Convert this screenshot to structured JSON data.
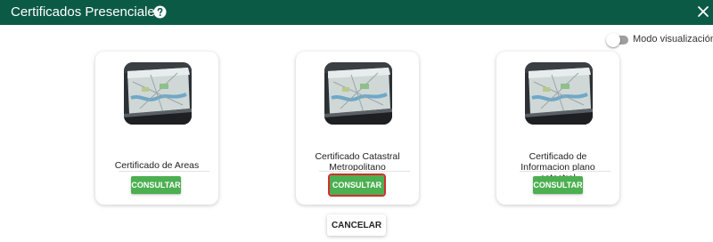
{
  "dialog": {
    "title": "Certificados Presenciales"
  },
  "toggle": {
    "label": "Modo visualización",
    "on": false
  },
  "cards": [
    {
      "title": "Certificado de Areas",
      "button": "CONSULTAR"
    },
    {
      "title": "Certificado Catastral Metropolitano",
      "button": "CONSULTAR"
    },
    {
      "title": "Certificado de Informacion plano catastral",
      "button": "CONSULTAR"
    }
  ],
  "footer": {
    "cancel": "CANCELAR"
  },
  "colors": {
    "header": "#0b5a45",
    "button": "#4caf50",
    "focus_outline": "#d32f2f"
  },
  "icons": {
    "help": "help-circle-icon",
    "close": "close-icon",
    "card_image": "map-laptop-image"
  }
}
